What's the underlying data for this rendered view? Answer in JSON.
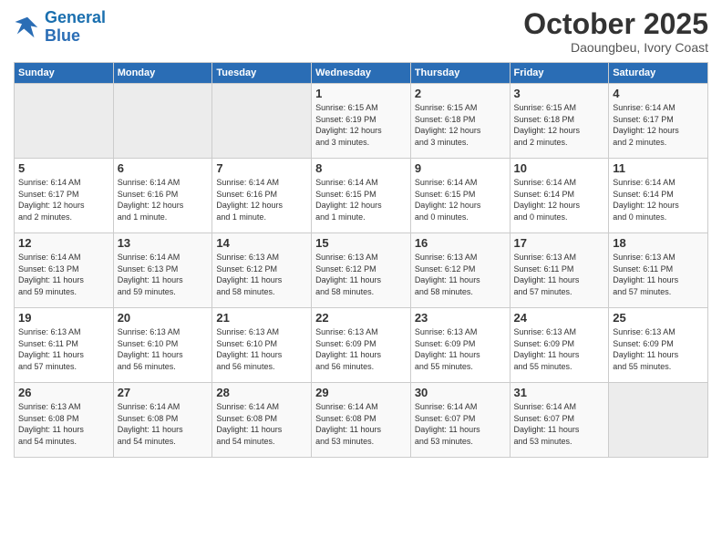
{
  "logo": {
    "line1": "General",
    "line2": "Blue"
  },
  "title": "October 2025",
  "location": "Daoungbeu, Ivory Coast",
  "weekdays": [
    "Sunday",
    "Monday",
    "Tuesday",
    "Wednesday",
    "Thursday",
    "Friday",
    "Saturday"
  ],
  "weeks": [
    [
      {
        "day": "",
        "info": ""
      },
      {
        "day": "",
        "info": ""
      },
      {
        "day": "",
        "info": ""
      },
      {
        "day": "1",
        "info": "Sunrise: 6:15 AM\nSunset: 6:19 PM\nDaylight: 12 hours\nand 3 minutes."
      },
      {
        "day": "2",
        "info": "Sunrise: 6:15 AM\nSunset: 6:18 PM\nDaylight: 12 hours\nand 3 minutes."
      },
      {
        "day": "3",
        "info": "Sunrise: 6:15 AM\nSunset: 6:18 PM\nDaylight: 12 hours\nand 2 minutes."
      },
      {
        "day": "4",
        "info": "Sunrise: 6:14 AM\nSunset: 6:17 PM\nDaylight: 12 hours\nand 2 minutes."
      }
    ],
    [
      {
        "day": "5",
        "info": "Sunrise: 6:14 AM\nSunset: 6:17 PM\nDaylight: 12 hours\nand 2 minutes."
      },
      {
        "day": "6",
        "info": "Sunrise: 6:14 AM\nSunset: 6:16 PM\nDaylight: 12 hours\nand 1 minute."
      },
      {
        "day": "7",
        "info": "Sunrise: 6:14 AM\nSunset: 6:16 PM\nDaylight: 12 hours\nand 1 minute."
      },
      {
        "day": "8",
        "info": "Sunrise: 6:14 AM\nSunset: 6:15 PM\nDaylight: 12 hours\nand 1 minute."
      },
      {
        "day": "9",
        "info": "Sunrise: 6:14 AM\nSunset: 6:15 PM\nDaylight: 12 hours\nand 0 minutes."
      },
      {
        "day": "10",
        "info": "Sunrise: 6:14 AM\nSunset: 6:14 PM\nDaylight: 12 hours\nand 0 minutes."
      },
      {
        "day": "11",
        "info": "Sunrise: 6:14 AM\nSunset: 6:14 PM\nDaylight: 12 hours\nand 0 minutes."
      }
    ],
    [
      {
        "day": "12",
        "info": "Sunrise: 6:14 AM\nSunset: 6:13 PM\nDaylight: 11 hours\nand 59 minutes."
      },
      {
        "day": "13",
        "info": "Sunrise: 6:14 AM\nSunset: 6:13 PM\nDaylight: 11 hours\nand 59 minutes."
      },
      {
        "day": "14",
        "info": "Sunrise: 6:13 AM\nSunset: 6:12 PM\nDaylight: 11 hours\nand 58 minutes."
      },
      {
        "day": "15",
        "info": "Sunrise: 6:13 AM\nSunset: 6:12 PM\nDaylight: 11 hours\nand 58 minutes."
      },
      {
        "day": "16",
        "info": "Sunrise: 6:13 AM\nSunset: 6:12 PM\nDaylight: 11 hours\nand 58 minutes."
      },
      {
        "day": "17",
        "info": "Sunrise: 6:13 AM\nSunset: 6:11 PM\nDaylight: 11 hours\nand 57 minutes."
      },
      {
        "day": "18",
        "info": "Sunrise: 6:13 AM\nSunset: 6:11 PM\nDaylight: 11 hours\nand 57 minutes."
      }
    ],
    [
      {
        "day": "19",
        "info": "Sunrise: 6:13 AM\nSunset: 6:11 PM\nDaylight: 11 hours\nand 57 minutes."
      },
      {
        "day": "20",
        "info": "Sunrise: 6:13 AM\nSunset: 6:10 PM\nDaylight: 11 hours\nand 56 minutes."
      },
      {
        "day": "21",
        "info": "Sunrise: 6:13 AM\nSunset: 6:10 PM\nDaylight: 11 hours\nand 56 minutes."
      },
      {
        "day": "22",
        "info": "Sunrise: 6:13 AM\nSunset: 6:09 PM\nDaylight: 11 hours\nand 56 minutes."
      },
      {
        "day": "23",
        "info": "Sunrise: 6:13 AM\nSunset: 6:09 PM\nDaylight: 11 hours\nand 55 minutes."
      },
      {
        "day": "24",
        "info": "Sunrise: 6:13 AM\nSunset: 6:09 PM\nDaylight: 11 hours\nand 55 minutes."
      },
      {
        "day": "25",
        "info": "Sunrise: 6:13 AM\nSunset: 6:09 PM\nDaylight: 11 hours\nand 55 minutes."
      }
    ],
    [
      {
        "day": "26",
        "info": "Sunrise: 6:13 AM\nSunset: 6:08 PM\nDaylight: 11 hours\nand 54 minutes."
      },
      {
        "day": "27",
        "info": "Sunrise: 6:14 AM\nSunset: 6:08 PM\nDaylight: 11 hours\nand 54 minutes."
      },
      {
        "day": "28",
        "info": "Sunrise: 6:14 AM\nSunset: 6:08 PM\nDaylight: 11 hours\nand 54 minutes."
      },
      {
        "day": "29",
        "info": "Sunrise: 6:14 AM\nSunset: 6:08 PM\nDaylight: 11 hours\nand 53 minutes."
      },
      {
        "day": "30",
        "info": "Sunrise: 6:14 AM\nSunset: 6:07 PM\nDaylight: 11 hours\nand 53 minutes."
      },
      {
        "day": "31",
        "info": "Sunrise: 6:14 AM\nSunset: 6:07 PM\nDaylight: 11 hours\nand 53 minutes."
      },
      {
        "day": "",
        "info": ""
      }
    ]
  ]
}
